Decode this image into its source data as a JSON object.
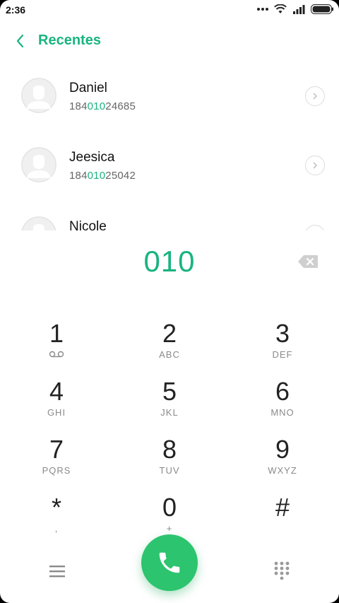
{
  "status": {
    "time": "2:36"
  },
  "header": {
    "title": "Recentes"
  },
  "recents": [
    {
      "name": "Daniel",
      "number_pre": "184",
      "number_hl": "010",
      "number_post": "24685"
    },
    {
      "name": "Jeesica",
      "number_pre": "184",
      "number_hl": "010",
      "number_post": "25042"
    },
    {
      "name": "Nicole",
      "number_pre": "",
      "number_hl": "",
      "number_post": ""
    }
  ],
  "dialer": {
    "entered": "010"
  },
  "keypad": {
    "rows": [
      [
        {
          "d": "1",
          "l": ""
        },
        {
          "d": "2",
          "l": "ABC"
        },
        {
          "d": "3",
          "l": "DEF"
        }
      ],
      [
        {
          "d": "4",
          "l": "GHI"
        },
        {
          "d": "5",
          "l": "JKL"
        },
        {
          "d": "6",
          "l": "MNO"
        }
      ],
      [
        {
          "d": "7",
          "l": "PQRS"
        },
        {
          "d": "8",
          "l": "TUV"
        },
        {
          "d": "9",
          "l": "WXYZ"
        }
      ],
      [
        {
          "d": "*",
          "l": ","
        },
        {
          "d": "0",
          "l": "+"
        },
        {
          "d": "#",
          "l": ""
        }
      ]
    ]
  },
  "colors": {
    "accent": "#19b47f",
    "call": "#2cc46e"
  },
  "icons": {
    "status": [
      "more-dots-icon",
      "wifi-icon",
      "signal-icon",
      "battery-icon"
    ],
    "header_back": "chevron-left-icon",
    "backspace": "backspace-icon",
    "call": "phone-icon",
    "menu": "menu-icon",
    "dialpad": "dialpad-icon"
  }
}
